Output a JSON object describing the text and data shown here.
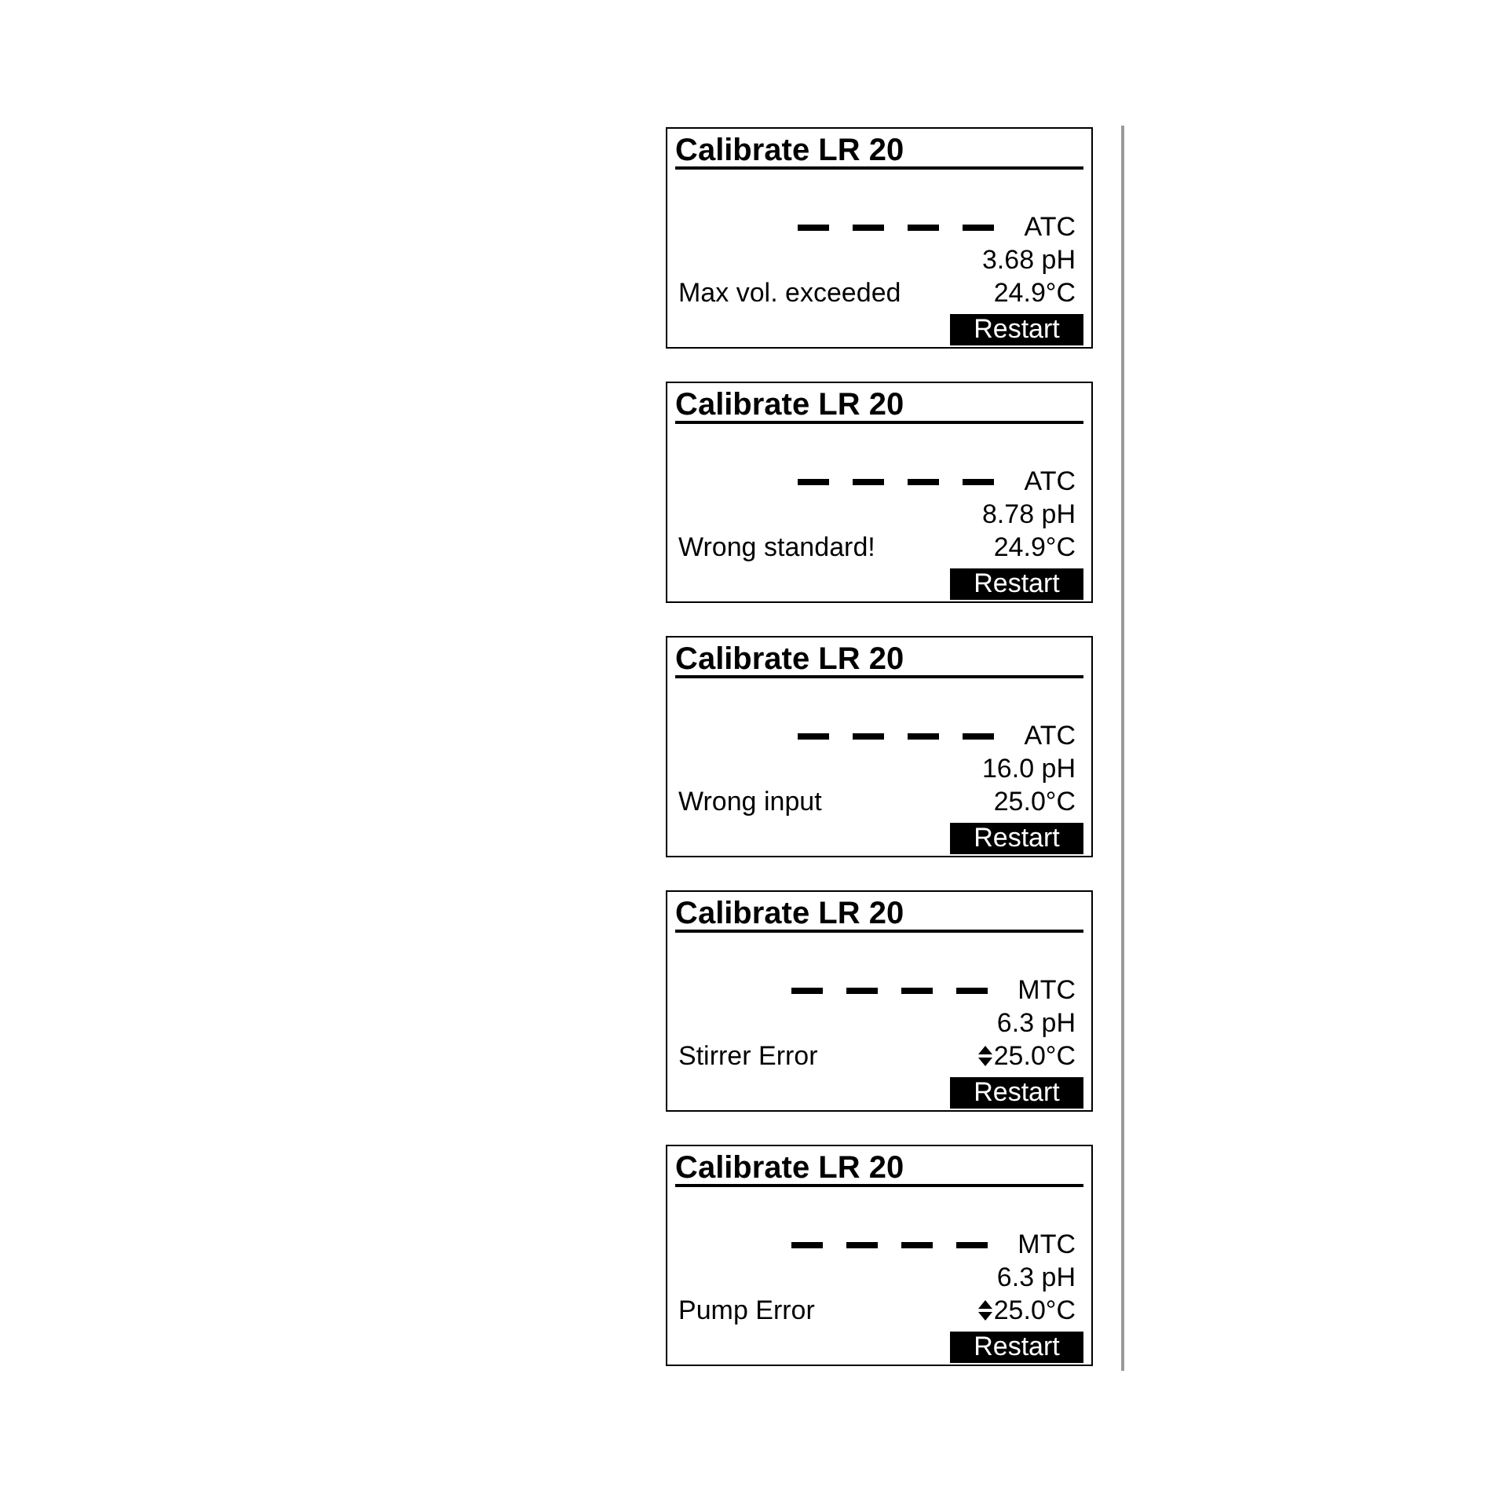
{
  "panels": [
    {
      "title": "Calibrate LR 20",
      "mode": "ATC",
      "ph": "3.68 pH",
      "message": "Max vol. exceeded",
      "temperature": "24.9°C",
      "temperature_adjustable": false,
      "button": "Restart"
    },
    {
      "title": "Calibrate LR 20",
      "mode": "ATC",
      "ph": "8.78 pH",
      "message": "Wrong standard!",
      "temperature": "24.9°C",
      "temperature_adjustable": false,
      "button": "Restart"
    },
    {
      "title": "Calibrate LR 20",
      "mode": "ATC",
      "ph": "16.0 pH",
      "message": "Wrong input",
      "temperature": "25.0°C",
      "temperature_adjustable": false,
      "button": "Restart"
    },
    {
      "title": "Calibrate LR 20",
      "mode": "MTC",
      "ph": "6.3 pH",
      "message": "Stirrer Error",
      "temperature": "25.0°C",
      "temperature_adjustable": true,
      "button": "Restart"
    },
    {
      "title": "Calibrate LR 20",
      "mode": "MTC",
      "ph": "6.3 pH",
      "message": "Pump Error",
      "temperature": "25.0°C",
      "temperature_adjustable": true,
      "button": "Restart"
    }
  ]
}
